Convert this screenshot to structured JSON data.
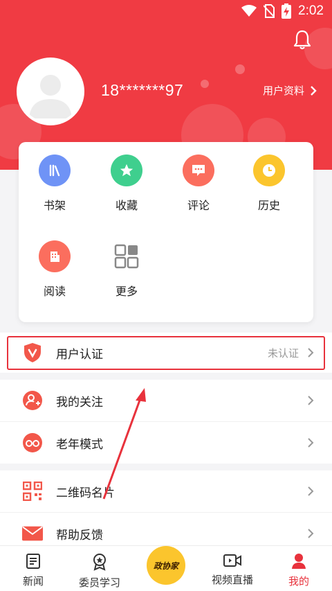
{
  "status": {
    "time": "2:02"
  },
  "profile": {
    "phone": "18*******97",
    "profile_link": "用户资料"
  },
  "grid": [
    {
      "label": "书架",
      "color": "#6f93f6",
      "icon": "bookshelf-icon"
    },
    {
      "label": "收藏",
      "color": "#3fcf8e",
      "icon": "star-icon"
    },
    {
      "label": "评论",
      "color": "#fb6e5e",
      "icon": "comment-icon"
    },
    {
      "label": "历史",
      "color": "#fbc52d",
      "icon": "clock-icon"
    },
    {
      "label": "阅读",
      "color": "#fb6e5e",
      "icon": "building-icon"
    },
    {
      "label": "更多",
      "color": "#8a8a8a",
      "icon": "grid-more-icon"
    }
  ],
  "list": {
    "auth": {
      "label": "用户认证",
      "status": "未认证"
    },
    "follow": {
      "label": "我的关注"
    },
    "elder": {
      "label": "老年模式"
    },
    "qrcode": {
      "label": "二维码名片"
    },
    "help": {
      "label": "帮助反馈"
    }
  },
  "nav": {
    "news": "新闻",
    "study": "委员学习",
    "center": "政协家",
    "video": "视频直播",
    "mine": "我的"
  },
  "colors": {
    "brand": "#f03b43",
    "active": "#e8323c"
  }
}
